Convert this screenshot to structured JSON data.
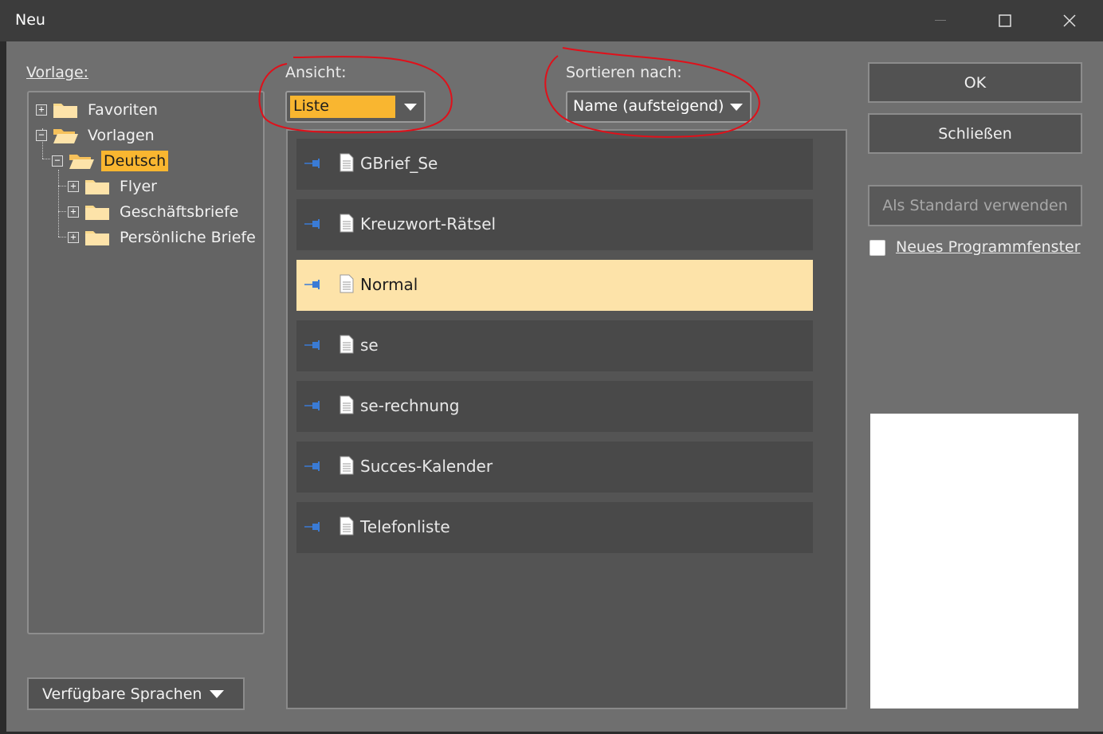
{
  "window": {
    "title": "Neu",
    "controls": {
      "minimize": "minimize-icon",
      "maximize": "maximize-icon",
      "close": "close-icon"
    }
  },
  "labels": {
    "vorlage": "Vorlage:",
    "ansicht": "Ansicht:",
    "sortieren": "Sortieren nach:"
  },
  "tree": {
    "items": [
      {
        "label": "Favoriten",
        "expander": "+",
        "level": 0
      },
      {
        "label": "Vorlagen",
        "expander": "−",
        "level": 0
      },
      {
        "label": "Deutsch",
        "expander": "−",
        "level": 1,
        "selected": true
      },
      {
        "label": "Flyer",
        "expander": "+",
        "level": 2
      },
      {
        "label": "Geschäftsbriefe",
        "expander": "+",
        "level": 2
      },
      {
        "label": "Persönliche Briefe",
        "expander": "+",
        "level": 2
      }
    ]
  },
  "view_combo": {
    "value": "Liste",
    "accent": "#f9b630"
  },
  "sort_combo": {
    "value": "Name (aufsteigend)"
  },
  "templates": [
    {
      "name": "GBrief_Se"
    },
    {
      "name": "Kreuzwort-Rätsel"
    },
    {
      "name": "Normal",
      "selected": true
    },
    {
      "name": "se"
    },
    {
      "name": "se-rechnung"
    },
    {
      "name": "Succes-Kalender"
    },
    {
      "name": "Telefonliste"
    }
  ],
  "buttons": {
    "ok": "OK",
    "close": "Schließen",
    "default": "Als Standard verwenden",
    "languages": "Verfügbare Sprachen"
  },
  "checkbox": {
    "label": "Neues Programmfenster",
    "checked": false
  },
  "colors": {
    "selection": "#f9b630",
    "row_selection": "#fde3a9",
    "pin": "#3a7bd5",
    "annotation": "#e0101a"
  }
}
